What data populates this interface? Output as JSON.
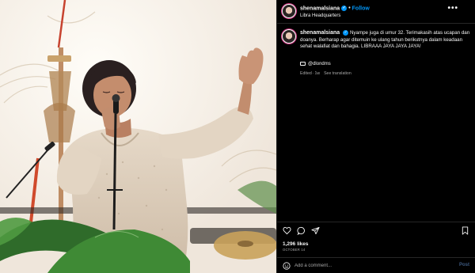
{
  "header": {
    "username": "shenamalsiana",
    "dot": "•",
    "follow_label": "Follow",
    "location": "Libra Headquarters",
    "more_label": "•••"
  },
  "caption": {
    "username": "shenamalsiana",
    "text": "Nyampe juga di umur 32. Terimakasih atas ucapan dan doanya. Berharap agar ditemuin ke ulang tahun berikutnya dalam keadaan sehat walafiat dan bahagia. LIBRAAA JAYA JAYA JAYA!",
    "mention": "@dlondms",
    "edited": "Edited",
    "time": "1w",
    "see_translation": "See translation"
  },
  "stats": {
    "likes": "1,296 likes",
    "date": "OCTOBER 14"
  },
  "comment_box": {
    "placeholder": "Add a comment...",
    "post_label": "Post"
  },
  "icons": [
    "verified-icon",
    "more-icon",
    "heart-icon",
    "comment-icon",
    "share-icon",
    "bookmark-icon",
    "emoji-icon",
    "tagged-people-icon"
  ],
  "colors": {
    "background": "#000000",
    "link": "#0095f6",
    "muted": "#a8a8a8",
    "post_disabled": "#3d5a80"
  }
}
